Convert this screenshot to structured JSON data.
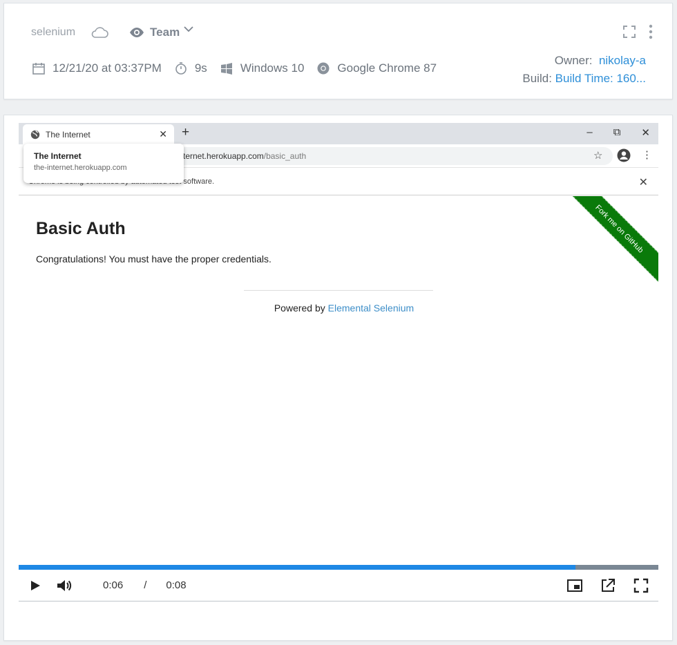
{
  "header": {
    "project": "selenium",
    "visibility_icon": "eye-icon",
    "visibility_label": "Team",
    "date": "12/21/20 at 03:37PM",
    "duration": "9s",
    "os": "Windows 10",
    "browser": "Google Chrome 87",
    "owner_label": "Owner:",
    "owner_value": "nikolay-a",
    "build_label": "Build:",
    "build_value": "Build Time: 160..."
  },
  "browser": {
    "tab_title": "The Internet",
    "new_tab": "+",
    "url_host": "ternet.herokuapp.com",
    "url_path": "/basic_auth",
    "infobar_text": "Chrome is being controlled by automated test software.",
    "hover_title": "The Internet",
    "hover_url": "the-internet.herokuapp.com"
  },
  "page": {
    "heading": "Basic Auth",
    "message": "Congratulations! You must have the proper credentials.",
    "powered_prefix": "Powered by ",
    "powered_link": "Elemental Selenium",
    "ribbon": "Fork me on GitHub"
  },
  "player": {
    "current_time": "0:06",
    "separator": "/",
    "duration": "0:08",
    "progress_fraction": 0.87
  },
  "colors": {
    "accent": "#1e88e5",
    "link": "#2e8fd8",
    "ribbon": "#0a7a0a"
  }
}
